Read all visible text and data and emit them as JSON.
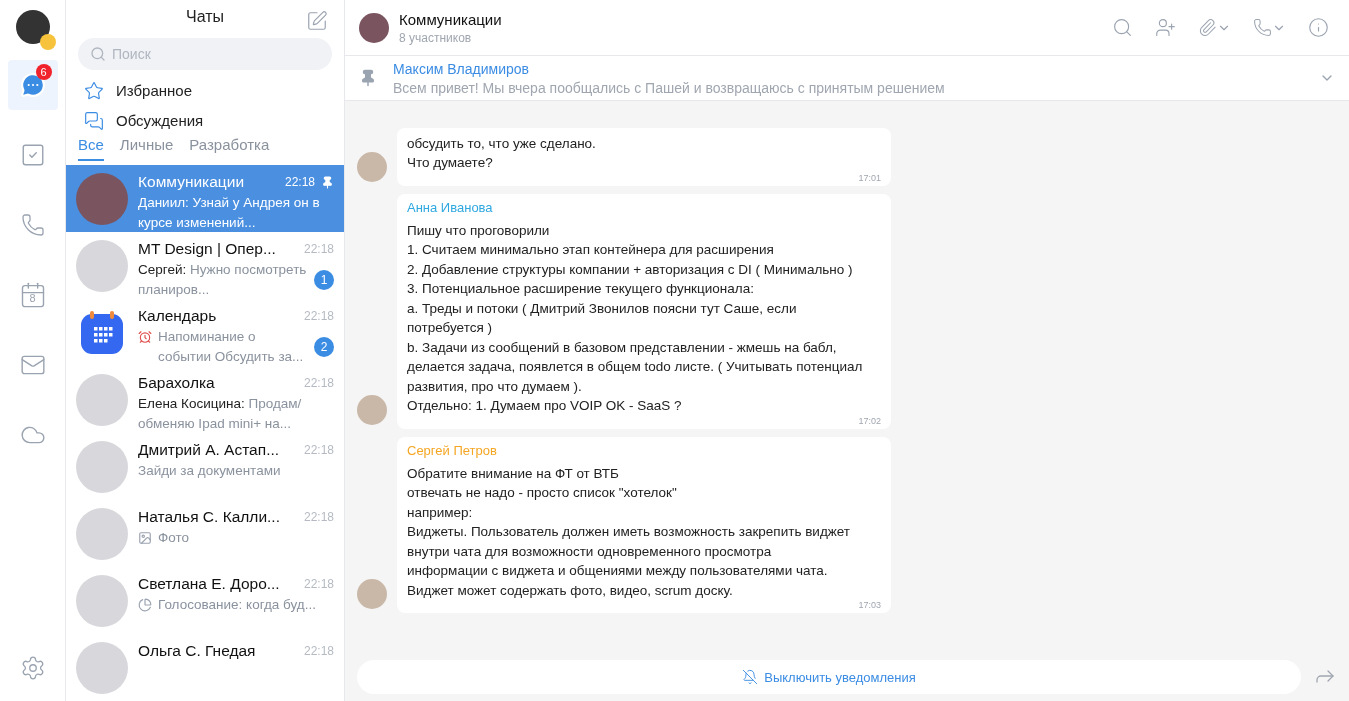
{
  "rail": {
    "items": [
      {
        "kind": "chats",
        "selected": true,
        "badge": "6"
      },
      {
        "kind": "tasks",
        "selected": false
      },
      {
        "kind": "calls",
        "selected": false
      },
      {
        "kind": "calendar",
        "selected": false,
        "label": "8"
      },
      {
        "kind": "mail",
        "selected": false
      },
      {
        "kind": "cloud",
        "selected": false
      }
    ]
  },
  "list": {
    "title": "Чаты",
    "search": {
      "placeholder": "Поиск"
    },
    "shortcuts": [
      {
        "kind": "favorites",
        "label": "Избранное"
      },
      {
        "kind": "discussions",
        "label": "Обсуждения"
      }
    ],
    "tabs": [
      {
        "label": "Все",
        "selected": true
      },
      {
        "label": "Личные",
        "selected": false
      },
      {
        "label": "Разработка",
        "selected": false
      }
    ],
    "chats": [
      {
        "kind": "chat",
        "name": "Коммуникации",
        "time": "22:18",
        "pinned": true,
        "selected": true,
        "preview": {
          "kind": "text",
          "sender": "Даниил:",
          "text": "Узнай у Андрея он в курсе изменений..."
        }
      },
      {
        "kind": "chat",
        "name": "MT Design | Опер...",
        "time": "22:18",
        "pinned": false,
        "selected": false,
        "preview": {
          "kind": "text",
          "sender": "Сергей:",
          "text": "Нужно посмотреть планиров..."
        },
        "unread": "1"
      },
      {
        "kind": "calendar",
        "name": "Календарь",
        "time": "22:18",
        "pinned": false,
        "selected": false,
        "preview": {
          "kind": "alarm",
          "text": "Напоминание о событии Обсудить за..."
        },
        "unread": "2"
      },
      {
        "kind": "chat",
        "name": "Барахолка",
        "time": "22:18",
        "pinned": false,
        "selected": false,
        "preview": {
          "kind": "text",
          "sender": "Елена Косицина:",
          "text": "Продам/ обменяю Ipad mini+ на..."
        }
      },
      {
        "kind": "chat",
        "name": "Дмитрий А. Астап...",
        "time": "22:18",
        "pinned": false,
        "selected": false,
        "preview": {
          "kind": "text",
          "text": "Зайди за документами"
        }
      },
      {
        "kind": "chat",
        "name": "Наталья С. Калли...",
        "time": "22:18",
        "pinned": false,
        "selected": false,
        "preview": {
          "kind": "photo",
          "text": "Фото"
        }
      },
      {
        "kind": "chat",
        "name": "Светлана Е. Доро...",
        "time": "22:18",
        "pinned": false,
        "selected": false,
        "preview": {
          "kind": "poll",
          "text": "Голосование: когда буд..."
        }
      },
      {
        "kind": "chat",
        "name": "Ольга С. Гнедая",
        "time": "22:18",
        "pinned": false,
        "selected": false
      }
    ]
  },
  "chat": {
    "title": "Коммуникации",
    "subtitle": "8 участников",
    "pinned_message": {
      "author": "Максим Владимиров",
      "text": "Всем привет! Мы вчера пообщались с Пашей и возвращаюсь с принятым решением"
    },
    "messages": [
      {
        "text": "обсудить то, что уже сделано.\nЧто думаете?",
        "time": "17:01"
      },
      {
        "author": "Анна Иванова",
        "color": "#2fa8e0",
        "text": "Пишу что проговорили\n1. Считаем минимально этап контейнера для расширения\n2. Добавление структуры компании + авторизация с DI ( Минимально )\n3. Потенциальное расширение текущего функционала:\na. Треды и потоки ( Дмитрий Звонилов поясни тут Саше, если\nпотребуется )\nb. Задачи из сообщений в базовом представлении - жмешь на бабл,\nделается задача, появлется в общем todo листе. ( Учитывать потенциал\nразвития, про что думаем ).\nОтдельно: 1. Думаем про VOIP OK - SaaS ?",
        "time": "17:02"
      },
      {
        "author": "Сергей Петров",
        "color": "#f5a623",
        "text": "Обратите внимание на ФТ от ВТБ\nотвечать не надо - просто список \"хотелок\"\nнапример:\nВиджеты. Пользователь должен иметь возможность закрепить виджет\nвнутри чата для возможности одновременного просмотра\nинформации с виджета и общениями между пользователями чата.\nВиджет может содержать фото, видео, scrum доску.",
        "time": "17:03"
      }
    ],
    "mute_button": "Выключить уведомления"
  }
}
